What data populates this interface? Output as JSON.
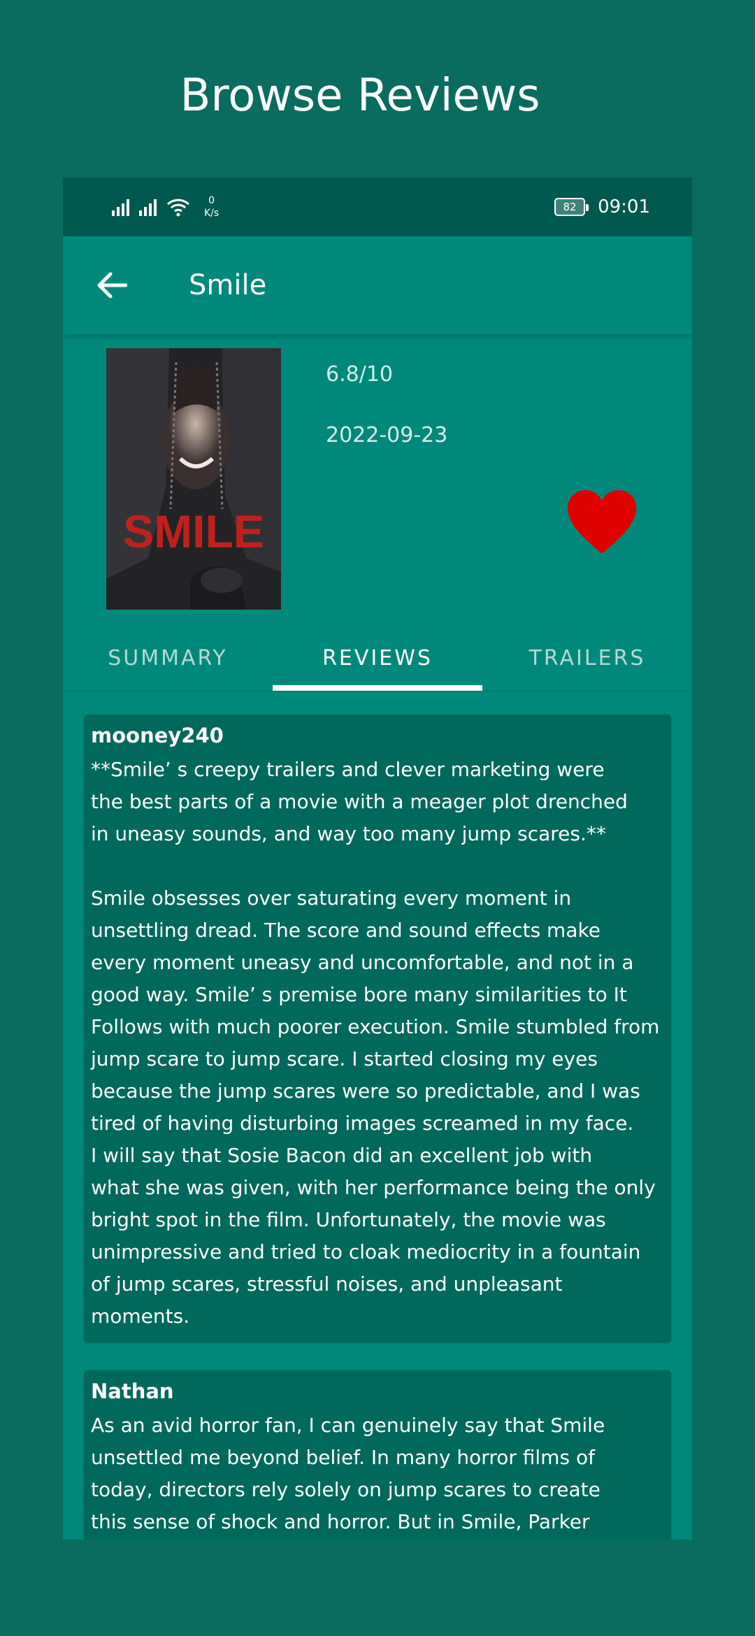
{
  "page": {
    "title": "Browse Reviews"
  },
  "status_bar": {
    "net_speed_value": "0",
    "net_speed_unit": "K/s",
    "battery": "82",
    "time": "09:01"
  },
  "app_bar": {
    "title": "Smile",
    "back_icon": "arrow-left-icon"
  },
  "movie": {
    "poster_text": "SMILE",
    "rating": "6.8/10",
    "release_date": "2022-09-23",
    "favorite_icon": "heart-icon",
    "favorite_color": "#e00000"
  },
  "tabs": [
    {
      "label": "SUMMARY"
    },
    {
      "label": "REVIEWS"
    },
    {
      "label": "TRAILERS"
    }
  ],
  "reviews": [
    {
      "author": "mooney240",
      "text": "**Smile’ s creepy trailers and clever marketing were\nthe best parts of a movie with a meager plot drenched\nin uneasy sounds, and way too many jump scares.**\n\nSmile obsesses over saturating every moment in\nunsettling dread. The score and sound effects make\nevery moment uneasy and uncomfortable, and not in a\ngood way. Smile’ s premise bore many similarities to It\nFollows with much poorer execution. Smile stumbled from\njump scare to jump scare. I started closing my eyes\nbecause the jump scares were so predictable, and I was\ntired of having disturbing images screamed in my face.\nI will say that Sosie Bacon did an excellent job with\nwhat she was given, with her performance being the only\nbright spot in the film. Unfortunately, the movie was\nunimpressive and tried to cloak mediocrity in a fountain\nof jump scares, stressful noises, and unpleasant\nmoments."
    },
    {
      "author": "Nathan",
      "text": "As an avid horror fan, I can genuinely say that Smile\nunsettled me beyond belief. In many horror films of\ntoday, directors rely solely on jump scares to create\nthis sense of shock and horror. But in Smile, Parker"
    }
  ],
  "colors": {
    "background": "#0a6c5e",
    "primary": "#00897b",
    "primary_dark": "#00594f",
    "card": "#00695c"
  }
}
